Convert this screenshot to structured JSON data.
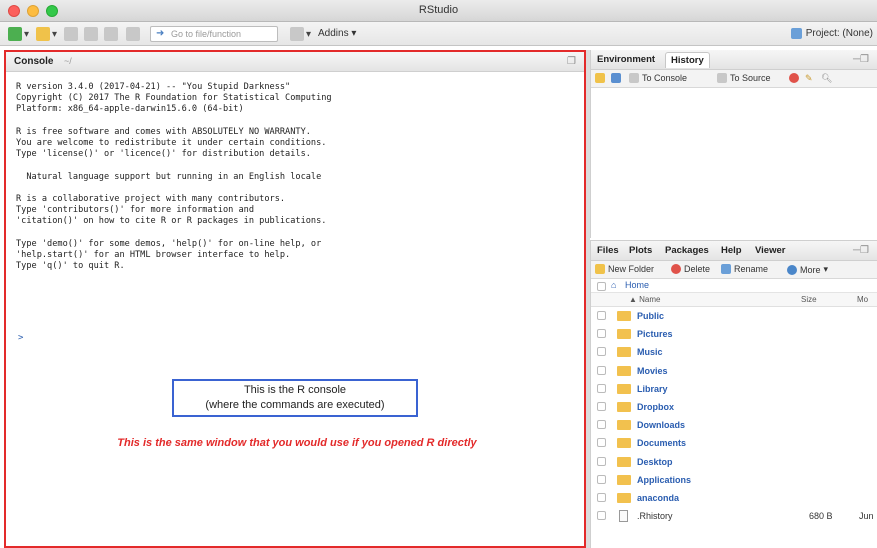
{
  "window": {
    "title": "RStudio"
  },
  "toolbar": {
    "go_to_file_placeholder": "Go to file/function",
    "addins_label": "Addins",
    "project_label": "Project: (None)"
  },
  "console": {
    "title": "Console",
    "path": "~/",
    "lines": [
      "R version 3.4.0 (2017-04-21) -- \"You Stupid Darkness\"",
      "Copyright (C) 2017 The R Foundation for Statistical Computing",
      "Platform: x86_64-apple-darwin15.6.0 (64-bit)",
      "",
      "R is free software and comes with ABSOLUTELY NO WARRANTY.",
      "You are welcome to redistribute it under certain conditions.",
      "Type 'license()' or 'licence()' for distribution details.",
      "",
      "  Natural language support but running in an English locale",
      "",
      "R is a collaborative project with many contributors.",
      "Type 'contributors()' for more information and",
      "'citation()' on how to cite R or R packages in publications.",
      "",
      "Type 'demo()' for some demos, 'help()' for on-line help, or",
      "'help.start()' for an HTML browser interface to help.",
      "Type 'q()' to quit R."
    ],
    "prompt": ">",
    "note_line1": "This is the R console",
    "note_line2": "(where the commands are executed)",
    "note_red": "This is the same window that you would use if you opened R directly"
  },
  "env_pane": {
    "tabs": [
      "Environment",
      "History"
    ],
    "to_console": "To Console",
    "to_source": "To Source"
  },
  "files_pane": {
    "tabs": [
      "Files",
      "Plots",
      "Packages",
      "Help",
      "Viewer"
    ],
    "new_folder": "New Folder",
    "delete": "Delete",
    "rename": "Rename",
    "more": "More",
    "home": "Home",
    "col_name": "Name",
    "col_size": "Size",
    "col_modified": "Mo",
    "files": [
      {
        "name": "Public",
        "type": "folder",
        "size": "",
        "modified": ""
      },
      {
        "name": "Pictures",
        "type": "folder",
        "size": "",
        "modified": ""
      },
      {
        "name": "Music",
        "type": "folder",
        "size": "",
        "modified": ""
      },
      {
        "name": "Movies",
        "type": "folder",
        "size": "",
        "modified": ""
      },
      {
        "name": "Library",
        "type": "folder",
        "size": "",
        "modified": ""
      },
      {
        "name": "Dropbox",
        "type": "folder",
        "size": "",
        "modified": ""
      },
      {
        "name": "Downloads",
        "type": "folder",
        "size": "",
        "modified": ""
      },
      {
        "name": "Documents",
        "type": "folder",
        "size": "",
        "modified": ""
      },
      {
        "name": "Desktop",
        "type": "folder",
        "size": "",
        "modified": ""
      },
      {
        "name": "Applications",
        "type": "folder",
        "size": "",
        "modified": ""
      },
      {
        "name": "anaconda",
        "type": "folder",
        "size": "",
        "modified": ""
      },
      {
        "name": ".Rhistory",
        "type": "file",
        "size": "680 B",
        "modified": "Jun"
      }
    ]
  }
}
